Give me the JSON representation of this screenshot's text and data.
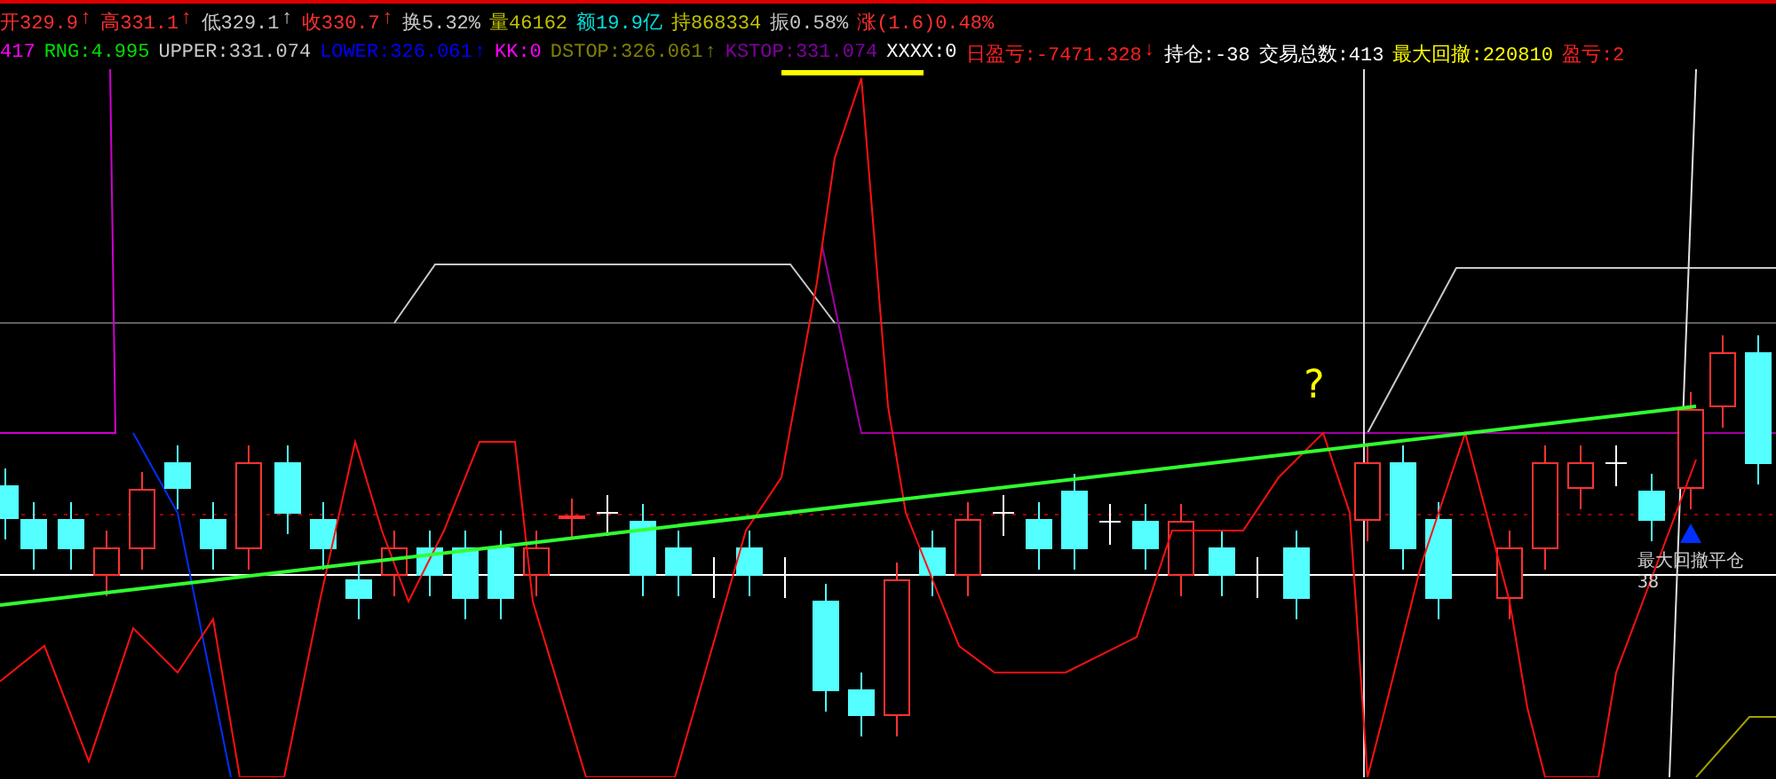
{
  "quote_bar": [
    {
      "text": "开329.9",
      "arrow": "↑",
      "color": "#ff3030"
    },
    {
      "text": "高331.1",
      "arrow": "↑",
      "color": "#ff3030"
    },
    {
      "text": "低329.1",
      "arrow": "↑",
      "color": "#c8c8c8"
    },
    {
      "text": "收330.7",
      "arrow": "↑",
      "color": "#ff3030"
    },
    {
      "text": "换5.32%",
      "color": "#c8c8c8"
    },
    {
      "text": "量46162",
      "color": "#c0c000"
    },
    {
      "text": "额19.9亿",
      "color": "#00e0e0"
    },
    {
      "text": "持868334",
      "color": "#c0c000"
    },
    {
      "text": "振0.58%",
      "color": "#c8c8c8"
    },
    {
      "text": "涨(1.6)0.48%",
      "color": "#ff3030"
    }
  ],
  "indicator_bar": [
    {
      "text": "417",
      "color": "#ff00ff"
    },
    {
      "text": "RNG:4.995",
      "color": "#00e000"
    },
    {
      "text": "UPPER:331.074",
      "color": "#c8c8c8"
    },
    {
      "text": "LOWER:326.061",
      "arrow": "↑",
      "color": "#0000ff"
    },
    {
      "text": "KK:0",
      "color": "#ff00ff"
    },
    {
      "text": "DSTOP:326.061",
      "arrow": "↑",
      "color": "#808000"
    },
    {
      "text": "KSTOP:331.074",
      "color": "#8000a0"
    },
    {
      "text": "XXXX:0",
      "color": "#ffffff"
    },
    {
      "text": "日盈亏:-7471.328",
      "arrow": "↓",
      "color": "#ff2020"
    },
    {
      "text": "持仓:-38",
      "color": "#ffffff"
    },
    {
      "text": "交易总数:413",
      "color": "#ffffff"
    },
    {
      "text": "最大回撤:220810",
      "color": "#ffff00"
    },
    {
      "text": "盈亏:2",
      "color": "#ff2020"
    }
  ],
  "chart": {
    "annotation": "?",
    "marker": {
      "label": "最大回撤平仓",
      "count": "38"
    }
  }
}
